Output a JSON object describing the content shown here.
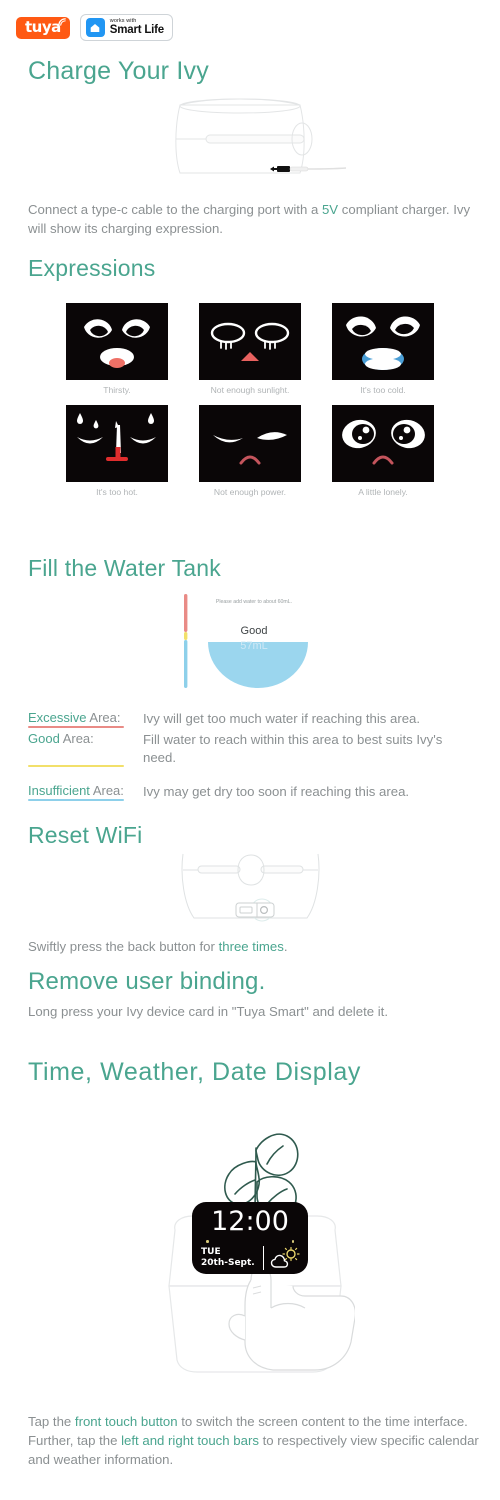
{
  "brand": {
    "tuya_logo_text": "tuya",
    "works_with_label": "works with",
    "smart_life_label": "Smart Life",
    "tuya_logo_color": "#ff5913",
    "smart_life_icon_color": "#2196f3",
    "accent_color": "#4aa58f",
    "body_text_color": "#8b9092"
  },
  "sections": {
    "charge": {
      "title": "Charge Your Ivy",
      "body_before": "Connect a type-c cable to the charging port with a ",
      "body_highlight": "5V",
      "body_after": " compliant charger. Ivy will show its charging expression."
    },
    "expressions": {
      "title": "Expressions",
      "items": [
        {
          "caption": "Thirsty.",
          "icon": "face-thirsty-icon"
        },
        {
          "caption": "Not enough sunlight.",
          "icon": "face-no-sunlight-icon"
        },
        {
          "caption": "It's too cold.",
          "icon": "face-too-cold-icon"
        },
        {
          "caption": "It's too hot.",
          "icon": "face-too-hot-icon"
        },
        {
          "caption": "Not enough power.",
          "icon": "face-low-power-icon"
        },
        {
          "caption": "A little lonely.",
          "icon": "face-lonely-icon"
        }
      ]
    },
    "water_tank": {
      "title": "Fill the Water Tank",
      "note": "Please add water to about 60mL.",
      "status_label": "Good",
      "volume_label": "57mL",
      "legend": [
        {
          "name": "Excessive",
          "suffix": " Area:",
          "color": "#e98b86",
          "desc": "Ivy will get too much water if reaching this area."
        },
        {
          "name": "Good",
          "suffix": " Area:",
          "color": "#f2e06a",
          "desc": "Fill water to reach within this area to best suits Ivy's need."
        },
        {
          "name": "Insufficient",
          "suffix": " Area:",
          "color": "#8dd0ea",
          "desc": "Ivy may get dry too soon if reaching this area."
        }
      ]
    },
    "reset_wifi": {
      "title": "Reset WiFi",
      "body_before": "Swiftly press the back button for ",
      "body_highlight": "three times",
      "body_after": "."
    },
    "remove_binding": {
      "title": "Remove user binding.",
      "body": "Long press your Ivy device card in \"Tuya Smart\" and delete it."
    },
    "time_weather": {
      "title": "Time, Weather, Date Display",
      "clock": {
        "time": "12:00",
        "weekday": "TUE",
        "date": "20th-Sept.",
        "weather_icon": "sun-behind-cloud-icon"
      },
      "body_part1": "Tap the ",
      "body_hl1": "front touch button",
      "body_part2": " to switch the screen content to the time interface. Further, tap the ",
      "body_hl2": "left and right touch bars",
      "body_part3": " to respectively view specific calendar and weather information."
    }
  }
}
